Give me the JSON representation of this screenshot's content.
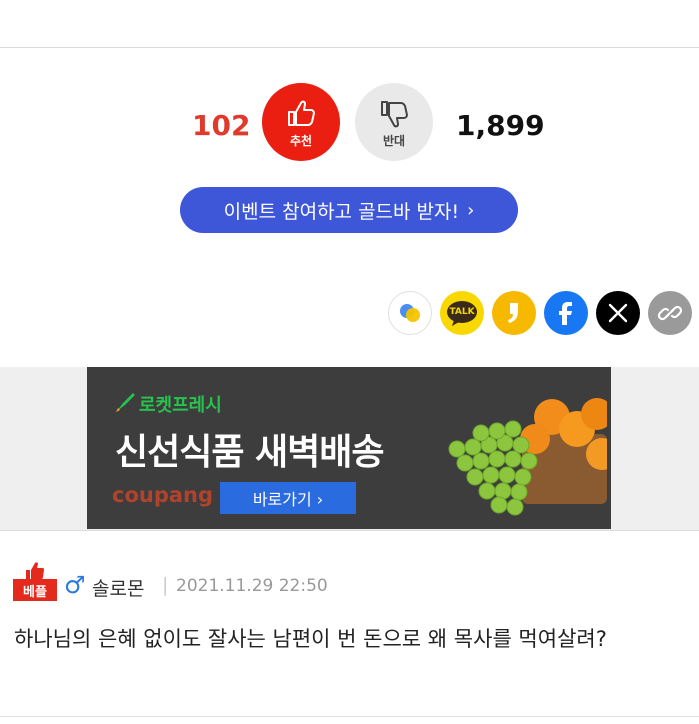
{
  "votes": {
    "up_count": "102",
    "up_label": "추천",
    "down_label": "반대",
    "down_count": "1,899"
  },
  "event_button": {
    "label": "이벤트 참여하고 골드바 받자!",
    "chevron": "›"
  },
  "share": {
    "kakaotalk_text": "TALK",
    "items": [
      "kakao-stories-icon",
      "kakaotalk-icon",
      "kakaostory-icon",
      "facebook-icon",
      "x-icon",
      "link-icon"
    ]
  },
  "ad": {
    "subtitle": "로켓프레시",
    "title": "신선식품 새벽배송",
    "brand": "coupang",
    "button": "바로가기 ›"
  },
  "comment": {
    "badge": "베플",
    "gender_symbol": "♂",
    "author": "솔로몬",
    "separator": "|",
    "timestamp": "2021.11.29 22:50",
    "text": "하나님의 은혜 없이도 잘사는 남편이 번 돈으로 왜 목사를 먹여살려?"
  },
  "colors": {
    "up": "#ea1f12",
    "down": "#e9e9e9",
    "event": "#3d57d8",
    "facebook": "#1877f2",
    "kakao": "#f9d800"
  }
}
